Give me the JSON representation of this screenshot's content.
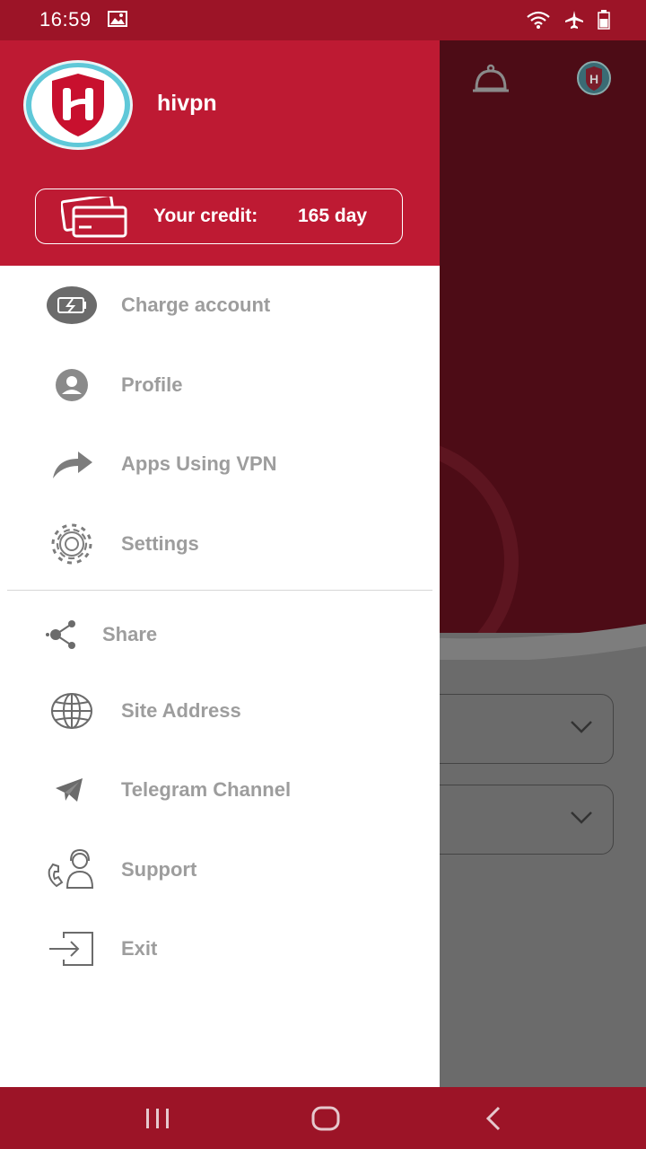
{
  "status_bar": {
    "time": "16:59"
  },
  "drawer": {
    "username": "hivpn",
    "credit_label": "Your credit:",
    "credit_value": "165 day",
    "menu_items": [
      {
        "label": "Charge account",
        "icon": "battery-charge-icon"
      },
      {
        "label": "Profile",
        "icon": "profile-icon"
      },
      {
        "label": "Apps Using VPN",
        "icon": "share-arrow-icon"
      },
      {
        "label": "Settings",
        "icon": "gear-icon"
      },
      {
        "label": "Share",
        "icon": "share-icon"
      },
      {
        "label": "Site Address",
        "icon": "globe-icon"
      },
      {
        "label": "Telegram Channel",
        "icon": "telegram-icon"
      },
      {
        "label": "Support",
        "icon": "support-agent-icon"
      },
      {
        "label": "Exit",
        "icon": "exit-icon"
      }
    ]
  },
  "colors": {
    "header_red": "#be1a33",
    "system_bar_red": "#9c1427",
    "menu_text_gray": "#9d9d9d",
    "background_dark_red": "#4d0c16",
    "overlay_gray": "#6b6b6b"
  }
}
